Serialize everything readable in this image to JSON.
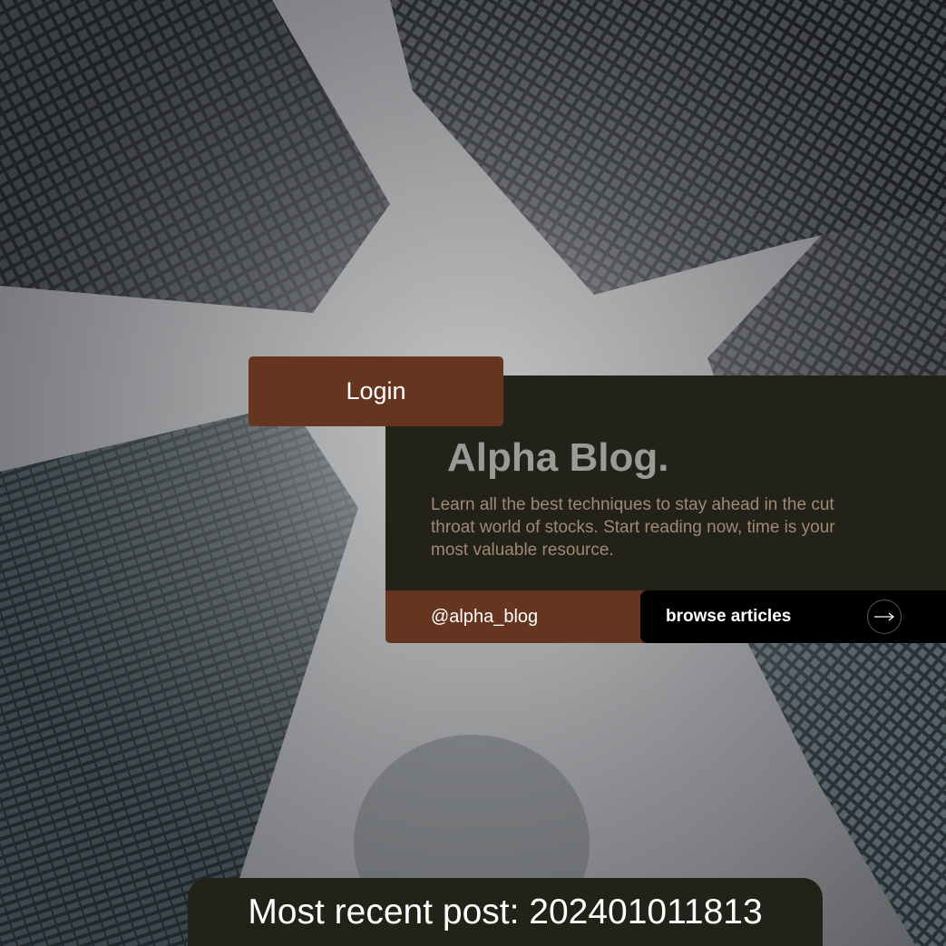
{
  "nav": {
    "login_label": "Login"
  },
  "hero": {
    "title": "Alpha Blog.",
    "description": "Learn all the best techniques to stay ahead in the cut throat world of stocks. Start reading now, time is your most valuable resource.",
    "handle": "@alpha_blog",
    "browse_label": "browse articles",
    "browse_icon": "arrow-right-icon"
  },
  "footer": {
    "recent_post": "Most recent post: 202401011813"
  },
  "colors": {
    "accent_brown": "#653520",
    "panel_dark": "#222218",
    "title_gray": "#9a9a98",
    "desc_tan": "#a28876"
  }
}
